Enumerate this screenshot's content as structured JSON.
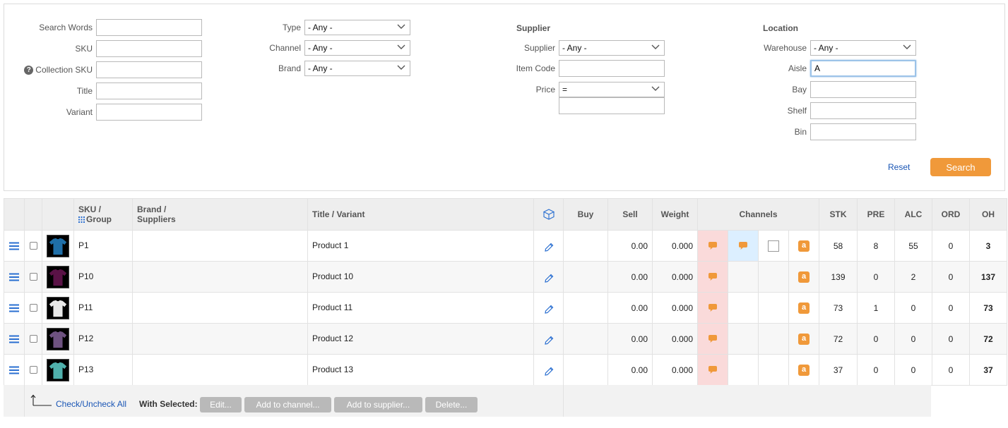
{
  "filters": {
    "search_words": {
      "label": "Search Words",
      "value": ""
    },
    "sku": {
      "label": "SKU",
      "value": ""
    },
    "collection_sku": {
      "label": "Collection SKU",
      "value": "",
      "info_glyph": "?"
    },
    "title": {
      "label": "Title",
      "value": ""
    },
    "variant": {
      "label": "Variant",
      "value": ""
    },
    "type": {
      "label": "Type",
      "value": "- Any -"
    },
    "channel": {
      "label": "Channel",
      "value": "- Any -"
    },
    "brand": {
      "label": "Brand",
      "value": "- Any -"
    },
    "supplier_heading": "Supplier",
    "supplier": {
      "label": "Supplier",
      "value": "- Any -"
    },
    "item_code": {
      "label": "Item Code",
      "value": ""
    },
    "price": {
      "label": "Price",
      "operator": "=",
      "value": ""
    },
    "location_heading": "Location",
    "warehouse": {
      "label": "Warehouse",
      "value": "- Any -"
    },
    "aisle": {
      "label": "Aisle",
      "value": "A"
    },
    "bay": {
      "label": "Bay",
      "value": ""
    },
    "shelf": {
      "label": "Shelf",
      "value": ""
    },
    "bin": {
      "label": "Bin",
      "value": ""
    },
    "reset_label": "Reset",
    "search_label": "Search"
  },
  "table": {
    "headers": {
      "sku_line1": "SKU /",
      "sku_line2": "Group",
      "brand_line1": "Brand /",
      "brand_line2": "Suppliers",
      "title_variant": "Title / Variant",
      "buy": "Buy",
      "sell": "Sell",
      "weight": "Weight",
      "channels": "Channels",
      "stk": "STK",
      "pre": "PRE",
      "alc": "ALC",
      "ord": "ORD",
      "oh": "OH"
    },
    "amazon_glyph": "a",
    "rows": [
      {
        "sku": "P1",
        "title": "Product 1",
        "buy": "",
        "sell": "0.00",
        "weight": "0.000",
        "stk": "58",
        "pre": "8",
        "alc": "55",
        "ord": "0",
        "oh": "3",
        "thumb_color": "#1f6fa8"
      },
      {
        "sku": "P10",
        "title": "Product 10",
        "buy": "",
        "sell": "0.00",
        "weight": "0.000",
        "stk": "139",
        "pre": "0",
        "alc": "2",
        "ord": "0",
        "oh": "137",
        "thumb_color": "#5a1246"
      },
      {
        "sku": "P11",
        "title": "Product 11",
        "buy": "",
        "sell": "0.00",
        "weight": "0.000",
        "stk": "73",
        "pre": "1",
        "alc": "0",
        "ord": "0",
        "oh": "73",
        "thumb_color": "#e8e8e8"
      },
      {
        "sku": "P12",
        "title": "Product 12",
        "buy": "",
        "sell": "0.00",
        "weight": "0.000",
        "stk": "72",
        "pre": "0",
        "alc": "0",
        "ord": "0",
        "oh": "72",
        "thumb_color": "#6e5280"
      },
      {
        "sku": "P13",
        "title": "Product 13",
        "buy": "",
        "sell": "0.00",
        "weight": "0.000",
        "stk": "37",
        "pre": "0",
        "alc": "0",
        "ord": "0",
        "oh": "37",
        "thumb_color": "#4fb0ac"
      }
    ]
  },
  "footer": {
    "check_all": "Check/Uncheck All",
    "with_selected": "With Selected:",
    "edit": "Edit...",
    "add_channel": "Add to channel...",
    "add_supplier": "Add to supplier...",
    "delete": "Delete..."
  },
  "colors": {
    "accent_orange": "#f0993a",
    "link_blue": "#1a56b5",
    "channel_pink": "#fadada",
    "channel_blue": "#dcefff"
  }
}
